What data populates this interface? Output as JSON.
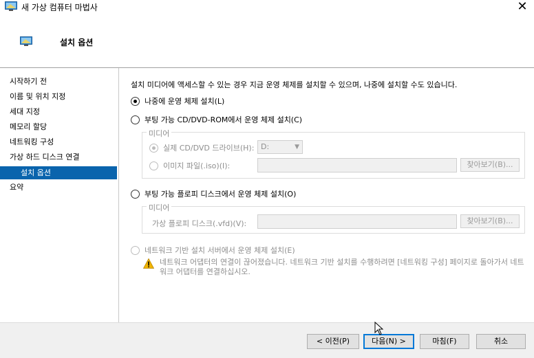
{
  "window": {
    "title": "새 가상 컴퓨터 마법사",
    "close_glyph": "✕"
  },
  "header": {
    "title": "설치 옵션"
  },
  "sidebar": {
    "items": [
      {
        "label": "시작하기 전",
        "active": false
      },
      {
        "label": "이름 및 위치 지정",
        "active": false
      },
      {
        "label": "세대 지정",
        "active": false
      },
      {
        "label": "메모리 할당",
        "active": false
      },
      {
        "label": "네트워킹 구성",
        "active": false
      },
      {
        "label": "가상 하드 디스크 연결",
        "active": false
      },
      {
        "label": "설치 옵션",
        "active": true
      },
      {
        "label": "요약",
        "active": false
      }
    ]
  },
  "content": {
    "intro": "설치 미디어에 액세스할 수 있는 경우 지금 운영 체제를 설치할 수 있으며, 나중에 설치할 수도 있습니다.",
    "option_later": "나중에 운영 체제 설치(L)",
    "option_cd": "부팅 가능 CD/DVD-ROM에서 운영 체제 설치(C)",
    "media_group_label": "미디어",
    "physical_drive_label": "실제 CD/DVD 드라이브(H):",
    "physical_drive_value": "D:",
    "image_file_label": "이미지 파일(.iso)(I):",
    "image_file_value": "",
    "browse_label": "찾아보기(B)...",
    "option_floppy": "부팅 가능 플로피 디스크에서 운영 체제 설치(O)",
    "floppy_group_label": "미디어",
    "vfd_label": "가상 플로피 디스크(.vfd)(V):",
    "vfd_value": "",
    "browse2_label": "찾아보기(B)...",
    "option_network": "네트워크 기반 설치 서버에서 운영 체제 설치(E)",
    "warning_text": "네트워크 어댑터의 연결이 끊어졌습니다. 네트워크 기반 설치를 수행하려면 [네트워킹 구성] 페이지로 돌아가서 네트워크 어댑터를 연결하십시오.",
    "selected_option": "later"
  },
  "footer": {
    "prev_label": "< 이전(P)",
    "next_label": "다음(N) >",
    "finish_label": "마침(F)",
    "cancel_label": "취소"
  },
  "colors": {
    "accent": "#0a64ad",
    "primary_border": "#0078d7",
    "warning": "#f0b400"
  }
}
